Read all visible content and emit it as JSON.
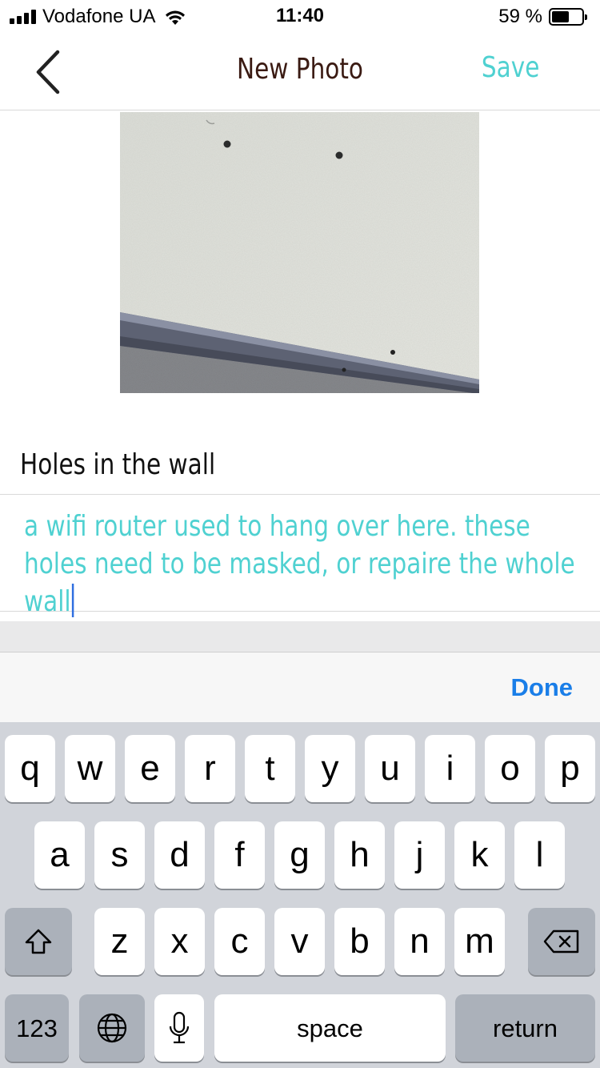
{
  "status_bar": {
    "carrier": "Vodafone UA",
    "time": "11:40",
    "battery_percent_label": "59 %",
    "battery_level": 0.59,
    "icons": [
      "signal-icon",
      "wifi-icon",
      "battery-icon"
    ]
  },
  "nav": {
    "back_icon": "chevron-left-icon",
    "title": "New Photo",
    "save_label": "Save"
  },
  "photo": {
    "subject": "wall-photo"
  },
  "form": {
    "title_value": "Holes in the wall",
    "notes_value": "a wifi router used to hang over here. these holes need to be masked, or repaire the whole wall"
  },
  "accessory": {
    "done_label": "Done"
  },
  "keyboard": {
    "row1": [
      "q",
      "w",
      "e",
      "r",
      "t",
      "y",
      "u",
      "i",
      "o",
      "p"
    ],
    "row2": [
      "a",
      "s",
      "d",
      "f",
      "g",
      "h",
      "j",
      "k",
      "l"
    ],
    "row3": [
      "z",
      "x",
      "c",
      "v",
      "b",
      "n",
      "m"
    ],
    "numbers_label": "123",
    "space_label": "space",
    "return_label": "return",
    "icons": [
      "shift-icon",
      "backspace-icon",
      "globe-icon",
      "microphone-icon"
    ]
  },
  "colors": {
    "accent": "#4fd1d1",
    "nav_title": "#3a1a12",
    "done": "#1a7ee8",
    "caret": "#2f6fe0",
    "keyboard_bg": "#d1d4da"
  }
}
